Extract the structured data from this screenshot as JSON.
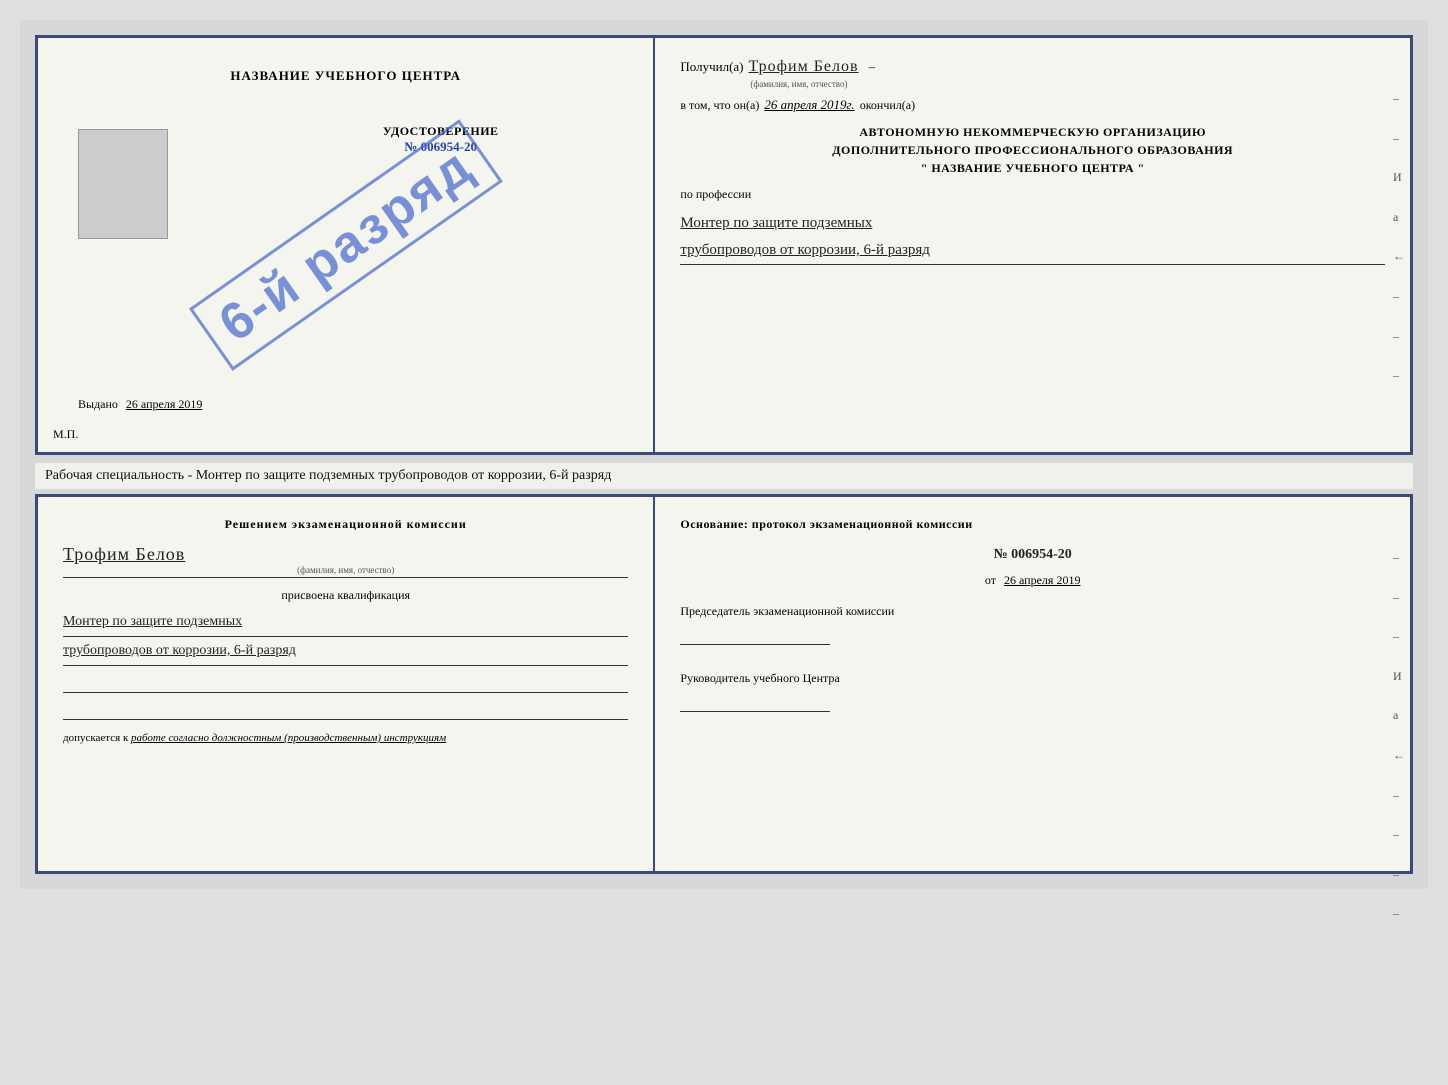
{
  "top_cert": {
    "left": {
      "title": "НАЗВАНИЕ УЧЕБНОГО ЦЕНТРА",
      "stamp_text": "6-й разряд",
      "udost_title": "УДОСТОВЕРЕНИЕ",
      "udost_number": "№ 006954-20",
      "vydano_label": "Выдано",
      "vydano_date": "26 апреля 2019",
      "mp": "М.П."
    },
    "right": {
      "poluchil_label": "Получил(а)",
      "name_handwritten": "Трофим Белов",
      "name_subtitle": "(фамилия, имя, отчество)",
      "dash": "–",
      "vtom_label": "в том, что он(а)",
      "date_handwritten": "26 апреля 2019г.",
      "okonchil_label": "окончил(а)",
      "org_line1": "АВТОНОМНУЮ НЕКОММЕРЧЕСКУЮ ОРГАНИЗАЦИЮ",
      "org_line2": "ДОПОЛНИТЕЛЬНОГО ПРОФЕССИОНАЛЬНОГО ОБРАЗОВАНИЯ",
      "org_line3": "\"    НАЗВАНИЕ УЧЕБНОГО ЦЕНТРА    \"",
      "po_professii": "по профессии",
      "profession_line1": "Монтер по защите подземных",
      "profession_line2": "трубопроводов от коррозии, 6-й разряд",
      "right_marks": [
        "–",
        "–",
        "И",
        "а",
        "←",
        "–",
        "–",
        "–"
      ]
    }
  },
  "caption": {
    "text": "Рабочая специальность - Монтер по защите подземных трубопроводов от коррозии, 6-й разряд"
  },
  "bottom_cert": {
    "left": {
      "resheniem_title": "Решением экзаменационной комиссии",
      "name_handwritten": "Трофим Белов",
      "name_subtitle": "(фамилия, имя, отчество)",
      "prisvoena_label": "присвоена квалификация",
      "profession_line1": "Монтер по защите подземных",
      "profession_line2": "трубопроводов от коррозии, 6-й разряд",
      "dopuskaetsya_label": "допускается к",
      "dopusk_italic": "работе согласно должностным (производственным) инструкциям"
    },
    "right": {
      "osnovanie_label": "Основание: протокол экзаменационной комиссии",
      "protocol_number": "№ 006954-20",
      "ot_prefix": "от",
      "ot_date": "26 апреля 2019",
      "chairman_title": "Председатель экзаменационной комиссии",
      "rukovoditel_title": "Руководитель учебного Центра",
      "right_marks": [
        "–",
        "–",
        "–",
        "И",
        "а",
        "←",
        "–",
        "–",
        "–",
        "–"
      ]
    }
  }
}
